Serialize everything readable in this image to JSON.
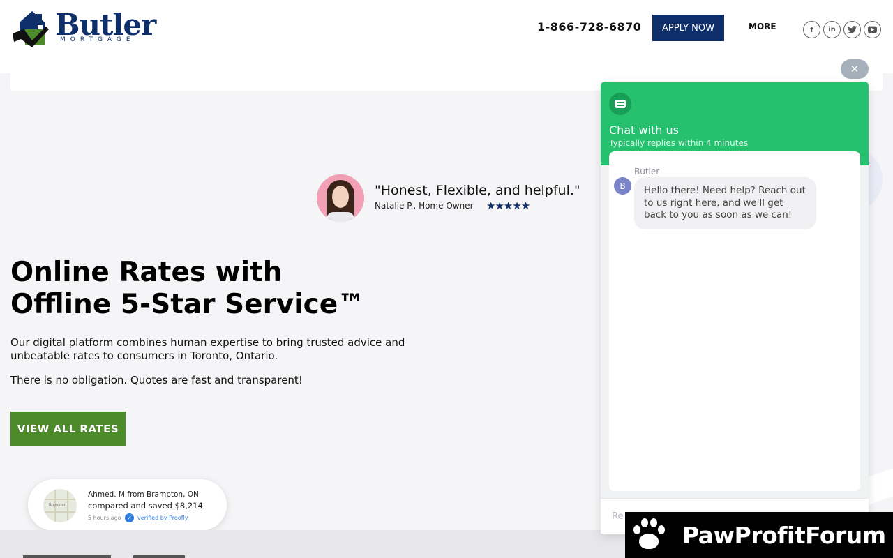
{
  "brand": {
    "name": "Butler",
    "sub": "MORTGAGE",
    "colors": {
      "navy": "#0f2f6b",
      "green": "#4d8a2a",
      "chat_green": "#25c16f"
    }
  },
  "header": {
    "phone": "1-866-728-6870",
    "apply_label": "APPLY NOW",
    "more_label": "MORE",
    "social": [
      {
        "icon": "facebook-icon",
        "glyph": "f"
      },
      {
        "icon": "linkedin-icon",
        "glyph": "in"
      },
      {
        "icon": "twitter-icon",
        "glyph": "t"
      },
      {
        "icon": "youtube-icon",
        "glyph": "▶"
      }
    ]
  },
  "testimonial": {
    "quote": "\"Honest, Flexible, and helpful.\"",
    "author": "Natalie P., Home Owner",
    "stars": 5
  },
  "hero": {
    "title_line1": "Online Rates with",
    "title_line2": "Offline 5-Star Service™",
    "description": "Our digital platform combines human expertise to bring trusted advice and unbeatable rates to consumers in Toronto, Ontario.",
    "note": "There is no obligation. Quotes are fast and transparent!",
    "cta_label": "VIEW ALL RATES"
  },
  "proof": {
    "line1": "Ahmed. M from Brampton, ON",
    "line2": "compared and saved $8,214",
    "time": "5 hours ago",
    "verified": "verified by Proofly",
    "map_label": "Brampton"
  },
  "chat": {
    "close_glyph": "✕",
    "title": "Chat with us",
    "subtitle": "Typically replies within 4 minutes",
    "sender": "Butler",
    "avatar_letter": "B",
    "message": "Hello there! Need help? Reach out to us right here, and we'll get back to you as soon as we can!",
    "input_placeholder": "Re"
  },
  "watermark": {
    "text": "PawProfitForum"
  }
}
